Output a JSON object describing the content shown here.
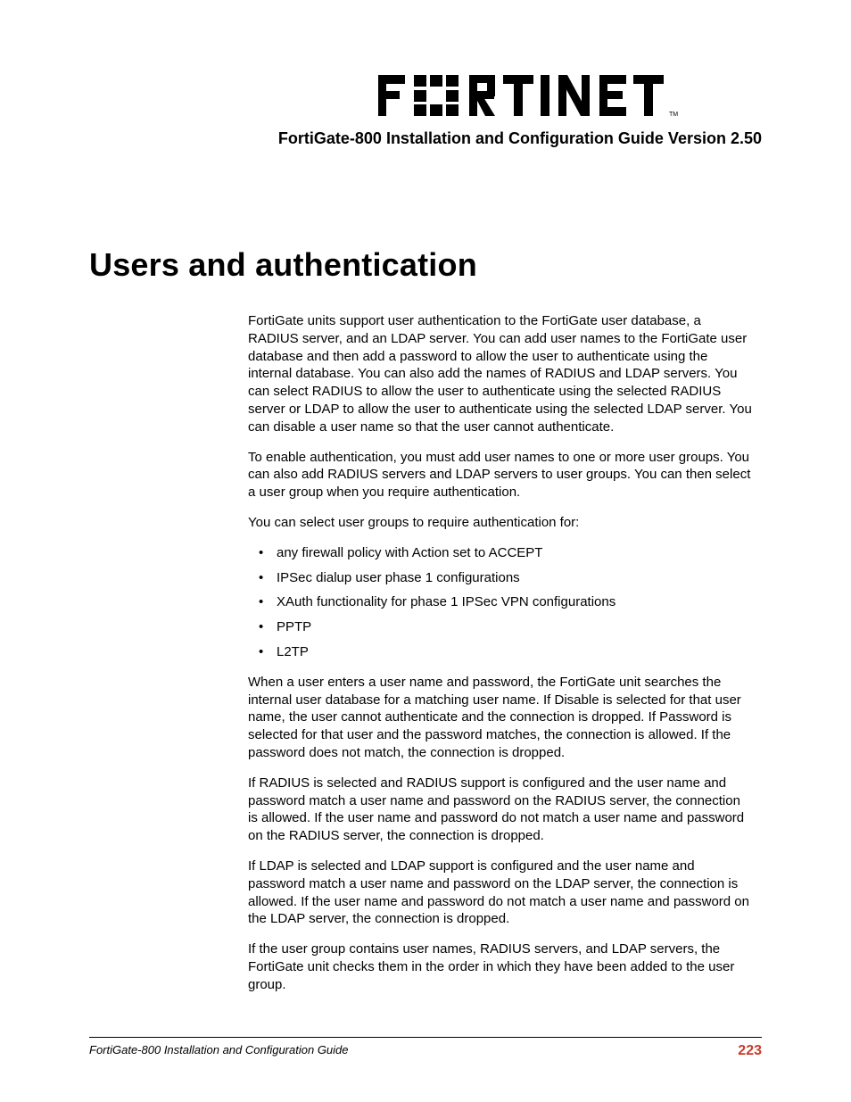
{
  "header": {
    "logo_alt": "FORTINET",
    "subtitle": "FortiGate-800 Installation and Configuration Guide Version 2.50"
  },
  "title": "Users and authentication",
  "paragraphs": {
    "p1": "FortiGate units support user authentication to the FortiGate user database, a RADIUS server, and an LDAP server. You can add user names to the FortiGate user database and then add a password to allow the user to authenticate using the internal database. You can also add the names of RADIUS and LDAP servers. You can select RADIUS to allow the user to authenticate using the selected RADIUS server or LDAP to allow the user to authenticate using the selected LDAP server. You can disable a user name so that the user cannot authenticate.",
    "p2": "To enable authentication, you must add user names to one or more user groups. You can also add RADIUS servers and LDAP servers to user groups. You can then select a user group when you require authentication.",
    "p3": "You can select user groups to require authentication for:",
    "p4": "When a user enters a user name and password, the FortiGate unit searches the internal user database for a matching user name. If Disable is selected for that user name, the user cannot authenticate and the connection is dropped. If Password is selected for that user and the password matches, the connection is allowed. If the password does not match, the connection is dropped.",
    "p5": "If RADIUS is selected and RADIUS support is configured and the user name and password match a user name and password on the RADIUS server, the connection is allowed. If the user name and password do not match a user name and password on the RADIUS server, the connection is dropped.",
    "p6": "If LDAP is selected and LDAP support is configured and the user name and password match a user name and password on the LDAP server, the connection is allowed. If the user name and password do not match a user name and password on the LDAP server, the connection is dropped.",
    "p7": "If the user group contains user names, RADIUS servers, and LDAP servers, the FortiGate unit checks them in the order in which they have been added to the user group."
  },
  "list": {
    "i0": "any firewall policy with Action set to ACCEPT",
    "i1": "IPSec dialup user phase 1 configurations",
    "i2": "XAuth functionality for phase 1 IPSec VPN configurations",
    "i3": "PPTP",
    "i4": "L2TP"
  },
  "footer": {
    "left": "FortiGate-800 Installation and Configuration Guide",
    "page": "223"
  }
}
